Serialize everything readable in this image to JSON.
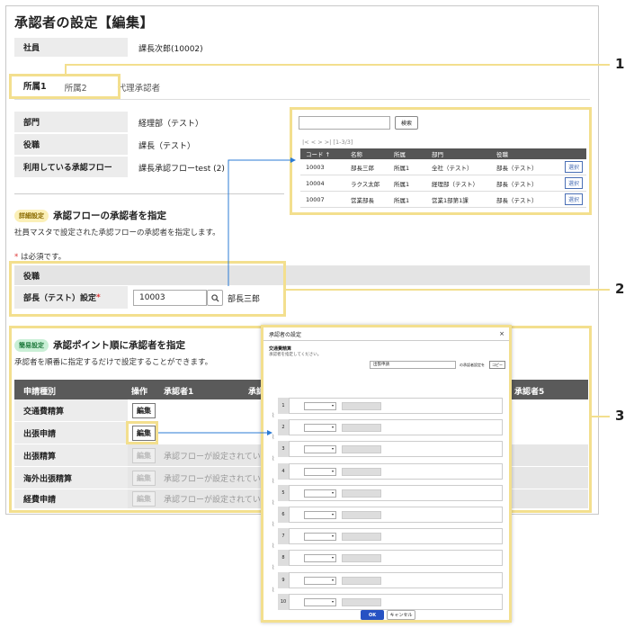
{
  "title": "承認者の設定【編集】",
  "employee": {
    "label": "社員",
    "value": "課長次郎(10002)"
  },
  "tabs": [
    {
      "label": "所属1",
      "active": true
    },
    {
      "label": "所属2",
      "active": false
    },
    {
      "label": "代理承認者",
      "active": false
    }
  ],
  "info_rows": [
    {
      "label": "部門",
      "value": "経理部（テスト）"
    },
    {
      "label": "役職",
      "value": "課長（テスト）"
    },
    {
      "label": "利用している承認フロー",
      "value": "課長承認フローtest (2)"
    }
  ],
  "popup": {
    "search_placeholder": "",
    "search_button": "検索",
    "pager": "|<  <  >  >|  [1-3/3]",
    "columns": [
      "コード ↑",
      "名称",
      "所属",
      "部門",
      "役職"
    ],
    "rows": [
      {
        "code": "10003",
        "name": "部長三郎",
        "affil": "所属1",
        "dept": "全社（テスト）",
        "post": "部長（テスト）"
      },
      {
        "code": "10004",
        "name": "ラクス太郎",
        "affil": "所属1",
        "dept": "経理部（テスト）",
        "post": "部長（テスト）"
      },
      {
        "code": "10007",
        "name": "営業部長",
        "affil": "所属1",
        "dept": "営業1部第1課",
        "post": "部長（テスト）"
      }
    ],
    "select_label": "選択"
  },
  "detail": {
    "badge": "詳細設定",
    "title": "承認フローの承認者を指定",
    "description": "社員マスタで設定された承認フローの承認者を指定します。",
    "required_note": "は必須です。",
    "required_mark": "*",
    "group_header": "役職",
    "field_label": "部長（テスト）設定",
    "field_value": "10003",
    "field_result": "部長三郎"
  },
  "simple": {
    "badge": "簡易設定",
    "title": "承認ポイント順に承認者を指定",
    "description": "承認者を順番に指定するだけで設定することができます。",
    "columns": [
      "申請種別",
      "操作",
      "承認者1",
      "承認者5"
    ],
    "col3_partial": "承認",
    "rows": [
      {
        "type": "交通費精算",
        "edit": "編集",
        "enabled": true,
        "note": ""
      },
      {
        "type": "出張申請",
        "edit": "編集",
        "enabled": true,
        "note": ""
      },
      {
        "type": "出張精算",
        "edit": "編集",
        "enabled": false,
        "note": "承認フローが設定されてい"
      },
      {
        "type": "海外出張精算",
        "edit": "編集",
        "enabled": false,
        "note": "承認フローが設定されてい"
      },
      {
        "type": "経費申請",
        "edit": "編集",
        "enabled": false,
        "note": "承認フローが設定されてい"
      }
    ]
  },
  "dialog": {
    "title": "承認者の設定",
    "close": "×",
    "sub_title": "交通費精算",
    "sub_desc": "承認者を指定してください。",
    "select_value": "出張申請",
    "copy_note": "の承認者設定を",
    "copy_button": "コピー",
    "steps": [
      "1",
      "2",
      "3",
      "4",
      "5",
      "6",
      "7",
      "8",
      "9",
      "10"
    ],
    "ok": "OK",
    "cancel": "キャンセル"
  },
  "callouts": [
    "1",
    "2",
    "3"
  ],
  "colors": {
    "highlight": "#f3df8e",
    "arrow": "#2b7bd6",
    "header": "#5a5a5a"
  }
}
